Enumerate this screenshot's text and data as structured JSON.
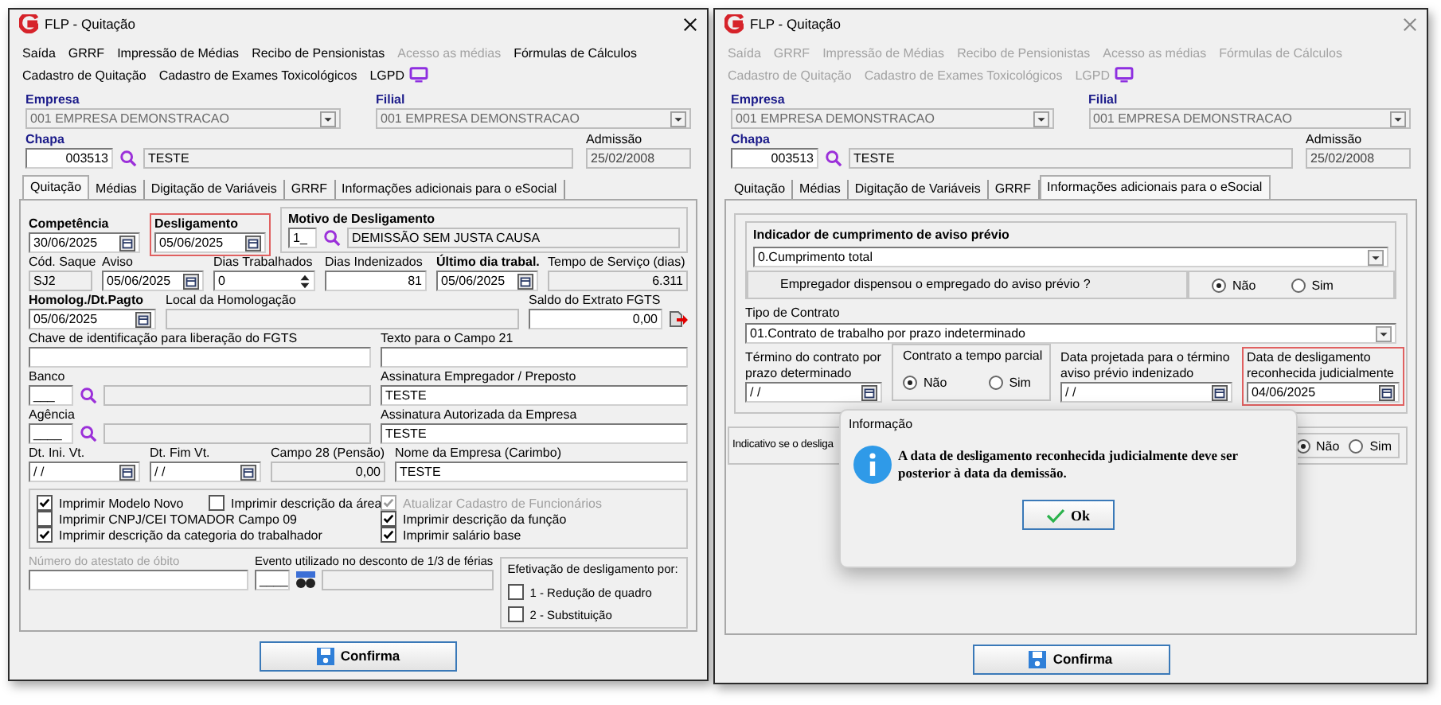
{
  "windows": [
    {
      "title": "FLP - Quitação",
      "active": true,
      "menu": [
        [
          {
            "label": "Saída",
            "disabled": false,
            "kind": "plain"
          },
          {
            "label": "GRRF",
            "disabled": false,
            "kind": "plain"
          },
          {
            "label": "Impressão de Médias",
            "disabled": false,
            "kind": "plain"
          },
          {
            "label": "Recibo de Pensionistas",
            "disabled": false,
            "kind": "plain"
          },
          {
            "label": "Acesso as médias",
            "disabled": true,
            "kind": "plain"
          },
          {
            "label": "Fórmulas de Cálculos",
            "disabled": false,
            "kind": "plain"
          }
        ],
        [
          {
            "label": "Cadastro de Quitação",
            "disabled": false,
            "kind": "plain"
          },
          {
            "label": "Cadastro de Exames Toxicológicos",
            "disabled": false,
            "kind": "plain"
          },
          {
            "label": "LGPD",
            "disabled": false,
            "kind": "with_icon"
          }
        ]
      ],
      "empresa": {
        "label": "Empresa",
        "value": "001 EMPRESA DEMONSTRACAO"
      },
      "filial": {
        "label": "Filial",
        "value": "001 EMPRESA DEMONSTRACAO"
      },
      "chapa": {
        "label": "Chapa",
        "code": "003513",
        "name": "TESTE"
      },
      "admissao": {
        "label": "Admissão",
        "value": "25/02/2008"
      },
      "tabs": [
        {
          "label": "Quitação",
          "selected": true
        },
        {
          "label": "Médias",
          "selected": false
        },
        {
          "label": "Digitação de Variáveis",
          "selected": false
        },
        {
          "label": "GRRF",
          "selected": false
        },
        {
          "label": "Informações adicionais para o eSocial",
          "selected": false
        }
      ],
      "panel": {
        "kind": "quitacao",
        "competencia": {
          "label": "Competência",
          "value": "30/06/2025"
        },
        "desligamento": {
          "label": "Desligamento",
          "value": "05/06/2025",
          "highlighted": true
        },
        "motivo": {
          "label": "Motivo de Desligamento",
          "code": "1_",
          "name": "DEMISSÃO SEM JUSTA CAUSA"
        },
        "cod_saque": {
          "label": "Cód. Saque",
          "value": "SJ2"
        },
        "aviso": {
          "label": "Aviso",
          "value": "05/06/2025"
        },
        "dias_trabalhados": {
          "label": "Dias Trabalhados",
          "value": "0"
        },
        "dias_indenizados": {
          "label": "Dias Indenizados",
          "value": "81"
        },
        "ultimo_dia": {
          "label": "Último dia trabal.",
          "value": "05/06/2025"
        },
        "tempo_servico": {
          "label": "Tempo de Serviço (dias)",
          "value": "6.311"
        },
        "homolog": {
          "label": "Homolog./Dt.Pagto",
          "value": "05/06/2025"
        },
        "local_homolog": {
          "label": "Local da Homologação"
        },
        "saldo_fgts": {
          "label": "Saldo do Extrato FGTS",
          "value": "0,00"
        },
        "chave_fgts": {
          "label": "Chave de identificação para liberação do FGTS"
        },
        "texto_campo21": {
          "label": "Texto para o Campo 21"
        },
        "banco": {
          "label": "Banco",
          "code": "___"
        },
        "assinatura_empregador": {
          "label": "Assinatura Empregador / Preposto",
          "value": "TESTE"
        },
        "agencia": {
          "label": "Agência",
          "code": "____"
        },
        "assinatura_empresa": {
          "label": "Assinatura Autorizada da Empresa",
          "value": "TESTE"
        },
        "dt_ini_vt": {
          "label": "Dt. Ini. Vt.",
          "value": "/ /"
        },
        "dt_fim_vt": {
          "label": "Dt. Fim Vt.",
          "value": "/ /"
        },
        "campo28": {
          "label": "Campo 28 (Pensão)",
          "value": "0,00"
        },
        "nome_empresa": {
          "label": "Nome da Empresa (Carimbo)",
          "value": "TESTE"
        },
        "options": [
          [
            {
              "label": "Imprimir Modelo Novo",
              "checked": true,
              "disabled": false
            },
            {
              "label": "Imprimir CNPJ/CEI TOMADOR Campo 09",
              "checked": false,
              "disabled": false
            },
            {
              "label": "Imprimir descrição da categoria do trabalhador",
              "checked": true,
              "disabled": false
            }
          ],
          [
            {
              "label": "Imprimir descrição da área",
              "checked": false,
              "disabled": false
            }
          ],
          [
            {
              "label": "Atualizar Cadastro de Funcionários",
              "checked": true,
              "disabled": true
            },
            {
              "label": "Imprimir descrição da função",
              "checked": true,
              "disabled": false
            },
            {
              "label": "Imprimir salário base",
              "checked": true,
              "disabled": false
            }
          ]
        ],
        "atestado": {
          "label": "Número do atestato de óbito",
          "disabled": true
        },
        "evento": {
          "label": "Evento utilizado no desconto de 1/3 de férias",
          "code": "____"
        },
        "efetivacao": {
          "title": "Efetivação de desligamento por:",
          "options": [
            {
              "label": "1 - Redução de quadro",
              "checked": false,
              "disabled": false
            },
            {
              "label": "2 - Substituição",
              "checked": false,
              "disabled": false
            }
          ]
        }
      },
      "confirm": "Confirma"
    },
    {
      "title": "FLP - Quitação",
      "active": false,
      "menu": [
        [
          {
            "label": "Saída",
            "disabled": true,
            "kind": "plain"
          },
          {
            "label": "GRRF",
            "disabled": true,
            "kind": "plain"
          },
          {
            "label": "Impressão de Médias",
            "disabled": true,
            "kind": "plain"
          },
          {
            "label": "Recibo de Pensionistas",
            "disabled": true,
            "kind": "plain"
          },
          {
            "label": "Acesso as médias",
            "disabled": true,
            "kind": "plain"
          },
          {
            "label": "Fórmulas de Cálculos",
            "disabled": true,
            "kind": "plain"
          }
        ],
        [
          {
            "label": "Cadastro de Quitação",
            "disabled": true,
            "kind": "plain"
          },
          {
            "label": "Cadastro de Exames Toxicológicos",
            "disabled": true,
            "kind": "plain"
          },
          {
            "label": "LGPD",
            "disabled": true,
            "kind": "with_icon"
          }
        ]
      ],
      "empresa": {
        "label": "Empresa",
        "value": "001 EMPRESA DEMONSTRACAO"
      },
      "filial": {
        "label": "Filial",
        "value": "001 EMPRESA DEMONSTRACAO"
      },
      "chapa": {
        "label": "Chapa",
        "code": "003513",
        "name": "TESTE"
      },
      "admissao": {
        "label": "Admissão",
        "value": "25/02/2008"
      },
      "tabs": [
        {
          "label": "Quitação",
          "selected": false
        },
        {
          "label": "Médias",
          "selected": false
        },
        {
          "label": "Digitação de Variáveis",
          "selected": false
        },
        {
          "label": "GRRF",
          "selected": false
        },
        {
          "label": "Informações adicionais para o eSocial",
          "selected": true
        }
      ],
      "panel": {
        "kind": "esocial",
        "aviso_group": {
          "title": "Indicador de cumprimento de aviso prévio",
          "value": "0.Cumprimento total",
          "question": "Empregador dispensou o empregado do aviso prévio ?",
          "options": [
            {
              "label": "Não",
              "selected": true
            },
            {
              "label": "Sim",
              "selected": false
            }
          ]
        },
        "tipo_contrato": {
          "label": "Tipo de Contrato",
          "value": "01.Contrato de trabalho por prazo indeterminado"
        },
        "termino": {
          "label": "Término do contrato por prazo determinado",
          "value": "/ /"
        },
        "tempo_parcial": {
          "title": "Contrato a tempo parcial",
          "options": [
            {
              "label": "Não",
              "selected": true
            },
            {
              "label": "Sim",
              "selected": false
            }
          ]
        },
        "data_projetada": {
          "label": "Data projetada para o término aviso prévio indenizado",
          "value": "/ /"
        },
        "data_judicial": {
          "label": "Data de desligamento reconhecida judicialmente",
          "value": "04/06/2025",
          "highlighted": true
        },
        "indicativo": {
          "label": "Indicativo se o desliga",
          "options": [
            {
              "label": "Não",
              "selected": true
            },
            {
              "label": "Sim",
              "selected": false
            }
          ]
        }
      },
      "confirm": "Confirma"
    }
  ],
  "dialog": {
    "title": "Informação",
    "message": "A data de desligamento reconhecida judicialmente deve ser posterior à data da demissão.",
    "ok": "Ok"
  }
}
